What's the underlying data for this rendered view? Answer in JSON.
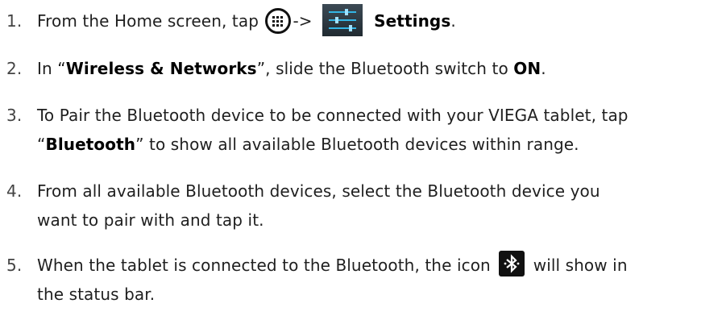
{
  "steps": [
    {
      "number": "1.",
      "pre": "From the Home screen, tap",
      "arrow": "->",
      "target": "Settings",
      "end": "."
    },
    {
      "number": "2.",
      "pre": "In “",
      "section": "Wireless & Networks",
      "mid": "”, slide the Bluetooth switch to",
      "state": "ON",
      "end": "."
    },
    {
      "number": "3.",
      "line1": "To Pair the Bluetooth device to be connected with your VIEGA tablet, tap",
      "quote_open": "“",
      "item": "Bluetooth",
      "line2": "” to show all available Bluetooth devices within range."
    },
    {
      "number": "4.",
      "line1": "From all available Bluetooth devices, select the Bluetooth device you",
      "line2": "want to pair with and tap it."
    },
    {
      "number": "5.",
      "pre": "When the tablet is connected to the Bluetooth, the icon",
      "post": "will show in",
      "line2": "the status bar."
    }
  ],
  "icons": {
    "apps": "apps-grid-icon",
    "settings": "settings-sliders-icon",
    "bluetooth": "bluetooth-icon"
  }
}
